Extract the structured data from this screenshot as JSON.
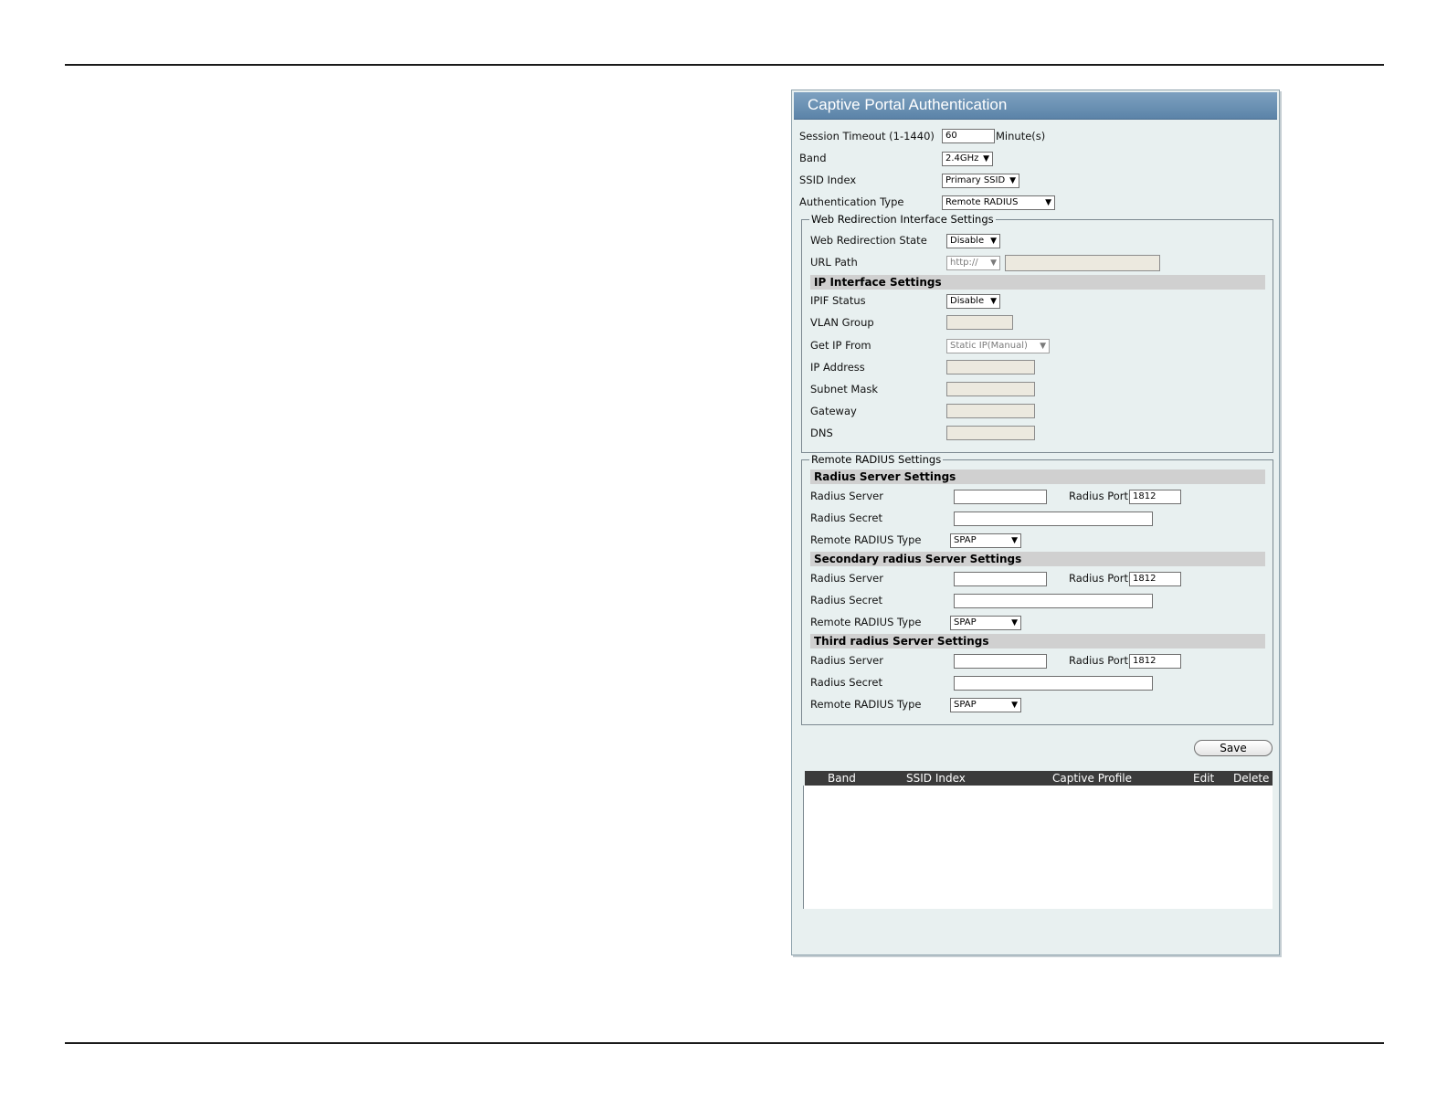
{
  "panel": {
    "title": "Captive Portal Authentication"
  },
  "general": {
    "session_timeout_label": "Session Timeout (1-1440)",
    "session_timeout_value": "60",
    "session_timeout_unit": "Minute(s)",
    "band_label": "Band",
    "band_value": "2.4GHz",
    "ssid_index_label": "SSID Index",
    "ssid_index_value": "Primary SSID",
    "auth_type_label": "Authentication Type",
    "auth_type_value": "Remote RADIUS"
  },
  "web_redirection": {
    "legend": "Web Redirection Interface Settings",
    "state_label": "Web Redirection State",
    "state_value": "Disable",
    "url_path_label": "URL Path",
    "url_scheme_value": "http://",
    "url_value": ""
  },
  "ip_interface": {
    "title": "IP Interface Settings",
    "ipif_status_label": "IPIF Status",
    "ipif_status_value": "Disable",
    "vlan_group_label": "VLAN Group",
    "get_ip_from_label": "Get IP From",
    "get_ip_from_value": "Static IP(Manual)",
    "ip_address_label": "IP Address",
    "subnet_mask_label": "Subnet Mask",
    "gateway_label": "Gateway",
    "dns_label": "DNS"
  },
  "radius": {
    "legend": "Remote RADIUS Settings",
    "primary_title": "Radius Server Settings",
    "secondary_title": "Secondary radius Server Settings",
    "third_title": "Third radius Server Settings",
    "server_label": "Radius Server",
    "port_label": "Radius Port",
    "port_value": "1812",
    "secret_label": "Radius Secret",
    "type_label": "Remote RADIUS Type",
    "type_value": "SPAP"
  },
  "actions": {
    "save_label": "Save"
  },
  "table": {
    "headers": [
      "Band",
      "SSID Index",
      "Captive Profile",
      "Edit",
      "Delete"
    ],
    "rows": []
  }
}
